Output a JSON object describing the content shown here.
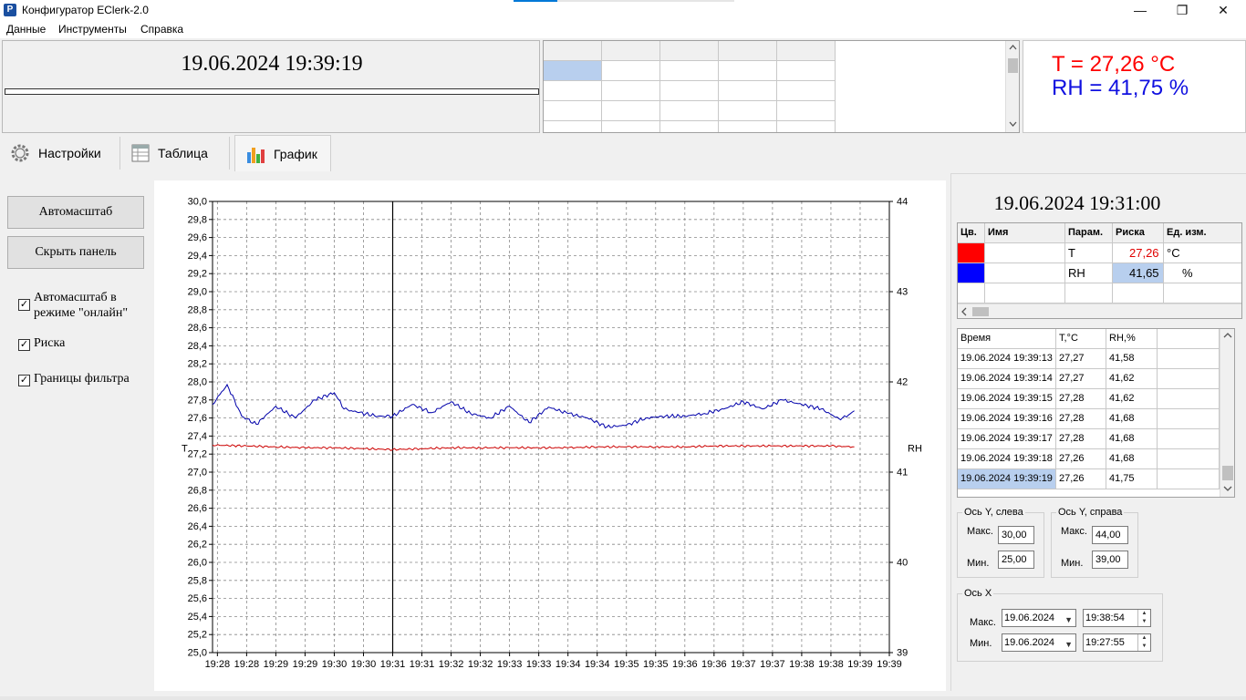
{
  "window": {
    "title": "Конфигуратор EClerk-2.0",
    "icon_letter": "P",
    "minimize": "—",
    "maximize": "❐",
    "close": "✕"
  },
  "menu": [
    "Данные",
    "Инструменты",
    "Справка"
  ],
  "top": {
    "datetime": "19.06.2024 19:39:19",
    "readout_t": "T = 27,26 °C",
    "readout_rh": "RH = 41,75 %"
  },
  "tabs": [
    {
      "label": "Настройки",
      "icon": "gear-icon"
    },
    {
      "label": "Таблица",
      "icon": "table-icon"
    },
    {
      "label": "График",
      "icon": "bar-chart-icon"
    }
  ],
  "left_panel": {
    "autoscale_button": "Автомасштаб",
    "hide_panel_button": "Скрыть панель",
    "chk_online_line1": "Автомасштаб в",
    "chk_online_line2": "режиме \"онлайн\"",
    "chk_marker": "Риска",
    "chk_filter": "Границы фильтра",
    "check_mark": "✓"
  },
  "chart_data": {
    "type": "line",
    "xlabel": "",
    "ylabel_left": "T",
    "ylabel_right": "RH",
    "ylim_left": [
      25.0,
      30.0
    ],
    "ylim_right": [
      39,
      44
    ],
    "x_ticks": [
      "19:28",
      "19:28",
      "19:29",
      "19:29",
      "19:30",
      "19:30",
      "19:31",
      "19:31",
      "19:32",
      "19:32",
      "19:33",
      "19:33",
      "19:34",
      "19:34",
      "19:35",
      "19:35",
      "19:36",
      "19:36",
      "19:37",
      "19:37",
      "19:38",
      "19:38",
      "19:39",
      "19:39"
    ],
    "y_left_ticks": [
      "30,0",
      "29,8",
      "29,6",
      "29,4",
      "29,2",
      "29,0",
      "28,8",
      "28,6",
      "28,4",
      "28,2",
      "28,0",
      "27,8",
      "27,6",
      "27,4",
      "27,2",
      "27,0",
      "26,8",
      "26,6",
      "26,4",
      "26,2",
      "26,0",
      "25,8",
      "25,6",
      "25,4",
      "25,2",
      "25,0"
    ],
    "y_right_ticks": [
      "44",
      "43",
      "42",
      "41",
      "40",
      "39"
    ],
    "grid": true,
    "cursor_time": "19:31",
    "series": [
      {
        "name": "T",
        "axis": "left",
        "color": "#cc0000",
        "x": [
          "19:27:55",
          "19:28:30",
          "19:29:00",
          "19:29:30",
          "19:30:00",
          "19:30:30",
          "19:31:00",
          "19:31:30",
          "19:32:00",
          "19:32:30",
          "19:33:00",
          "19:33:30",
          "19:34:00",
          "19:34:30",
          "19:35:00",
          "19:35:30",
          "19:36:00",
          "19:36:30",
          "19:37:00",
          "19:37:30",
          "19:38:00",
          "19:38:30",
          "19:38:54"
        ],
        "values": [
          27.3,
          27.29,
          27.28,
          27.27,
          27.27,
          27.26,
          27.25,
          27.26,
          27.27,
          27.27,
          27.27,
          27.27,
          27.27,
          27.28,
          27.28,
          27.28,
          27.28,
          27.29,
          27.29,
          27.29,
          27.29,
          27.29,
          27.28
        ]
      },
      {
        "name": "RH",
        "axis": "right",
        "color": "#0000aa",
        "x": [
          "19:27:55",
          "19:28:10",
          "19:28:25",
          "19:28:40",
          "19:29:00",
          "19:29:20",
          "19:29:40",
          "19:30:00",
          "19:30:10",
          "19:30:25",
          "19:30:45",
          "19:31:00",
          "19:31:20",
          "19:31:40",
          "19:32:00",
          "19:32:20",
          "19:32:40",
          "19:33:00",
          "19:33:20",
          "19:33:40",
          "19:34:00",
          "19:34:20",
          "19:34:40",
          "19:35:00",
          "19:35:20",
          "19:35:40",
          "19:36:00",
          "19:36:20",
          "19:36:40",
          "19:37:00",
          "19:37:20",
          "19:37:40",
          "19:38:00",
          "19:38:20",
          "19:38:40",
          "19:38:54"
        ],
        "values": [
          41.75,
          41.97,
          41.62,
          41.53,
          41.73,
          41.6,
          41.8,
          41.88,
          41.7,
          41.66,
          41.62,
          41.62,
          41.75,
          41.66,
          41.78,
          41.65,
          41.6,
          41.73,
          41.55,
          41.72,
          41.65,
          41.6,
          41.5,
          41.52,
          41.6,
          41.62,
          41.62,
          41.65,
          41.7,
          41.78,
          41.7,
          41.8,
          41.75,
          41.7,
          41.58,
          41.68
        ]
      }
    ]
  },
  "right": {
    "datetime": "19.06.2024 19:31:00",
    "param_headers": [
      "Цв.",
      "Имя",
      "Парам.",
      "Риска",
      "Ед. изм."
    ],
    "params": [
      {
        "color": "#ff0000",
        "name": "",
        "param": "T",
        "value": "27,26",
        "unit": "°C",
        "value_color": "#e00000"
      },
      {
        "color": "#0000ff",
        "name": "",
        "param": "RH",
        "value": "41,65",
        "unit": "%",
        "value_color": "#000000"
      }
    ],
    "log_headers": [
      "Время",
      "T,°C",
      "RH,%"
    ],
    "log_rows": [
      [
        "19.06.2024 19:39:13",
        "27,27",
        "41,58"
      ],
      [
        "19.06.2024 19:39:14",
        "27,27",
        "41,62"
      ],
      [
        "19.06.2024 19:39:15",
        "27,28",
        "41,62"
      ],
      [
        "19.06.2024 19:39:16",
        "27,28",
        "41,68"
      ],
      [
        "19.06.2024 19:39:17",
        "27,28",
        "41,68"
      ],
      [
        "19.06.2024 19:39:18",
        "27,26",
        "41,68"
      ],
      [
        "19.06.2024 19:39:19",
        "27,26",
        "41,75"
      ]
    ],
    "axis_y_left": {
      "title": "Ось Y, слева",
      "max_label": "Макс.",
      "max": "30,00",
      "min_label": "Мин.",
      "min": "25,00"
    },
    "axis_y_right": {
      "title": "Ось Y, справа",
      "max_label": "Макс.",
      "max": "44,00",
      "min_label": "Мин.",
      "min": "39,00"
    },
    "axis_x": {
      "title": "Ось X",
      "max_label": "Макс.",
      "max_date": "19.06.2024",
      "max_time": "19:38:54",
      "min_label": "Мин.",
      "min_date": "19.06.2024",
      "min_time": "19:27:55"
    }
  }
}
